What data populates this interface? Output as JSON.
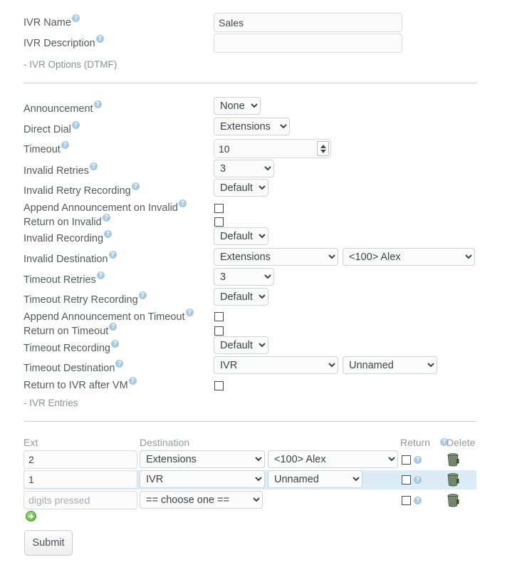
{
  "form": {
    "ivr_name": {
      "label": "IVR Name",
      "value": "Sales",
      "help": "help-icon"
    },
    "ivr_description": {
      "label": "IVR Description",
      "value": "",
      "placeholder": ""
    },
    "section_options": "- IVR Options (DTMF)",
    "section_entries": "- IVR Entries",
    "announcement": {
      "label": "Announcement",
      "value": "None"
    },
    "direct_dial": {
      "label": "Direct Dial",
      "value": "Extensions"
    },
    "timeout": {
      "label": "Timeout",
      "value": "10"
    },
    "invalid_retries": {
      "label": "Invalid Retries",
      "value": "3"
    },
    "invalid_retry_recording": {
      "label": "Invalid Retry Recording",
      "value": "Default"
    },
    "append_announcement_invalid": {
      "label": "Append Announcement on Invalid",
      "checked": false
    },
    "return_on_invalid": {
      "label": "Return on Invalid",
      "checked": false
    },
    "invalid_recording": {
      "label": "Invalid Recording",
      "value": "Default"
    },
    "invalid_destination": {
      "label": "Invalid Destination",
      "value": "Extensions",
      "target": "<100> Alex"
    },
    "timeout_retries": {
      "label": "Timeout Retries",
      "value": "3"
    },
    "timeout_retry_recording": {
      "label": "Timeout Retry Recording",
      "value": "Default"
    },
    "append_announcement_timeout": {
      "label": "Append Announcement on Timeout",
      "checked": false
    },
    "return_on_timeout": {
      "label": "Return on Timeout",
      "checked": false
    },
    "timeout_recording": {
      "label": "Timeout Recording",
      "value": "Default"
    },
    "timeout_destination": {
      "label": "Timeout Destination",
      "value": "IVR",
      "target": "Unnamed"
    },
    "return_to_ivr_after_vm": {
      "label": "Return to IVR after VM",
      "checked": false
    }
  },
  "entries": {
    "headers": {
      "ext": "Ext",
      "destination": "Destination",
      "return": "Return",
      "delete": "Delete"
    },
    "rows": [
      {
        "ext": "2",
        "ext_placeholder": "",
        "destination": "Extensions",
        "target": "<100> Alex",
        "has_target": true,
        "return_checked": false,
        "highlight": false
      },
      {
        "ext": "1",
        "ext_placeholder": "",
        "destination": "IVR",
        "target": "Unnamed",
        "has_target": true,
        "return_checked": false,
        "highlight": true
      },
      {
        "ext": "",
        "ext_placeholder": "digits pressed",
        "destination": "== choose one ==",
        "target": "",
        "has_target": false,
        "return_checked": false,
        "highlight": false
      }
    ],
    "add_label": "add-row-icon",
    "delete_icon": "trash-icon"
  },
  "actions": {
    "submit_label": "Submit"
  },
  "colors": {
    "label_text": "#555b60",
    "help_blue": "#a8c9e0",
    "row_highlight": "#dcecf7",
    "divider": "#c9cdd1",
    "add_green": "#5fae3c"
  }
}
